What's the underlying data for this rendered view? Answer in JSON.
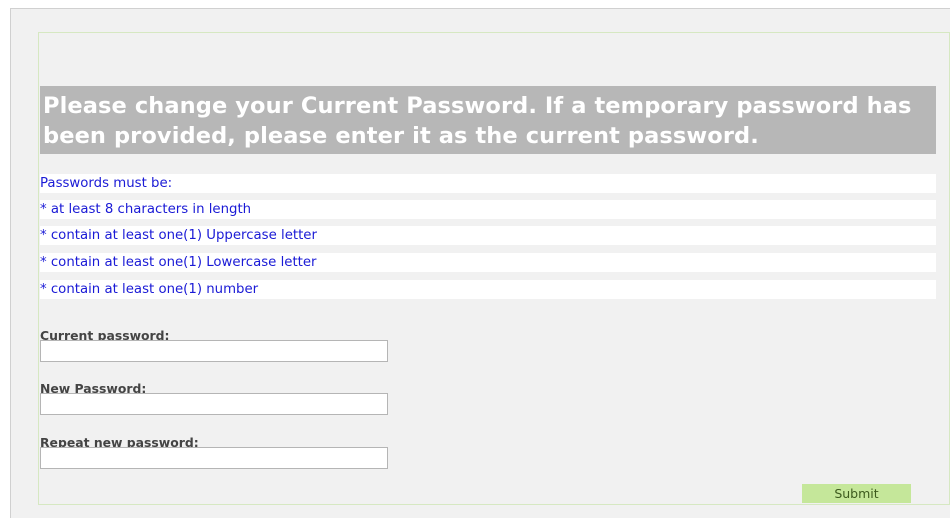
{
  "form": {
    "heading": "Please change your Current Password. If a temporary password has been provided, please enter it as the current password.",
    "rules": [
      "Passwords must be:",
      "* at least 8 characters in length",
      "* contain at least one(1) Uppercase letter",
      "* contain at least one(1) Lowercase letter",
      "* contain at least one(1) number"
    ],
    "fields": [
      {
        "label": "Current password:",
        "value": ""
      },
      {
        "label": "New Password:",
        "value": ""
      },
      {
        "label": "Repeat new password:",
        "value": ""
      }
    ],
    "submit_label": "Submit"
  },
  "colors": {
    "heading_bg": "#b7b7b7",
    "rule_text": "#1a1ad6",
    "submit_bg": "#c5e79a",
    "panel_border": "#d6e8c2"
  }
}
